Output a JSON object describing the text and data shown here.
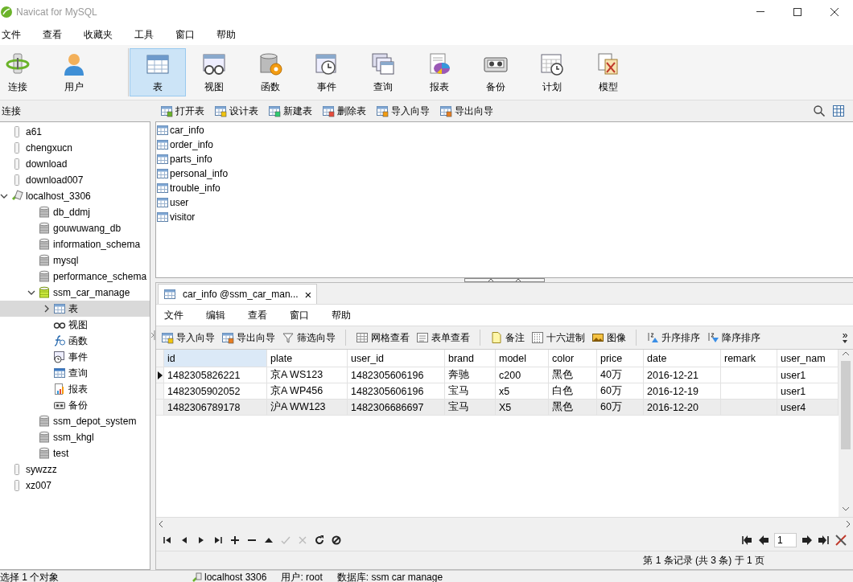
{
  "window": {
    "title": "Navicat for MySQL"
  },
  "menu": [
    "文件",
    "查看",
    "收藏夹",
    "工具",
    "窗口",
    "帮助"
  ],
  "toolbar": [
    {
      "label": "连接",
      "selected": false
    },
    {
      "label": "用户",
      "selected": false
    },
    {
      "label": "表",
      "selected": true
    },
    {
      "label": "视图",
      "selected": false
    },
    {
      "label": "函数",
      "selected": false
    },
    {
      "label": "事件",
      "selected": false
    },
    {
      "label": "查询",
      "selected": false
    },
    {
      "label": "报表",
      "selected": false
    },
    {
      "label": "备份",
      "selected": false
    },
    {
      "label": "计划",
      "selected": false
    },
    {
      "label": "模型",
      "selected": false
    }
  ],
  "sidebar": {
    "header": "连接",
    "tree": [
      {
        "label": "a61",
        "kind": "connection",
        "open": false,
        "selected": false
      },
      {
        "label": "chengxucn",
        "kind": "connection",
        "open": false,
        "selected": false
      },
      {
        "label": "download",
        "kind": "connection",
        "open": false,
        "selected": false
      },
      {
        "label": "download007",
        "kind": "connection",
        "open": false,
        "selected": false
      },
      {
        "label": "localhost_3306",
        "kind": "connection",
        "open": true,
        "selected": false,
        "expanded": true,
        "children": [
          {
            "label": "db_ddmj",
            "kind": "database",
            "open": false,
            "selected": false
          },
          {
            "label": "gouwuwang_db",
            "kind": "database",
            "open": false,
            "selected": false
          },
          {
            "label": "information_schema",
            "kind": "database",
            "open": false,
            "selected": false
          },
          {
            "label": "mysql",
            "kind": "database",
            "open": false,
            "selected": false
          },
          {
            "label": "performance_schema",
            "kind": "database",
            "open": false,
            "selected": false
          },
          {
            "label": "ssm_car_manage",
            "kind": "database",
            "open": true,
            "selected": false,
            "expanded": true,
            "children": [
              {
                "label": "表",
                "kind": "tables",
                "selected": true,
                "expanded": false
              },
              {
                "label": "视图",
                "kind": "views",
                "selected": false
              },
              {
                "label": "函数",
                "kind": "functions",
                "selected": false
              },
              {
                "label": "事件",
                "kind": "events",
                "selected": false
              },
              {
                "label": "查询",
                "kind": "queries",
                "selected": false
              },
              {
                "label": "报表",
                "kind": "reports",
                "selected": false
              },
              {
                "label": "备份",
                "kind": "backups",
                "selected": false
              }
            ]
          },
          {
            "label": "ssm_depot_system",
            "kind": "database",
            "open": false,
            "selected": false
          },
          {
            "label": "ssm_khgl",
            "kind": "database",
            "open": false,
            "selected": false
          },
          {
            "label": "test",
            "kind": "database",
            "open": false,
            "selected": false
          }
        ]
      },
      {
        "label": "sywzzz",
        "kind": "connection",
        "open": false,
        "selected": false
      },
      {
        "label": "xz007",
        "kind": "connection",
        "open": false,
        "selected": false
      }
    ]
  },
  "object_toolbar": [
    "打开表",
    "设计表",
    "新建表",
    "删除表",
    "导入向导",
    "导出向导"
  ],
  "objects": [
    "car_info",
    "order_info",
    "parts_info",
    "personal_info",
    "trouble_info",
    "user",
    "visitor"
  ],
  "tab": {
    "label": "car_info @ssm_car_man...",
    "close": "×",
    "selected": true
  },
  "editor_menu": [
    "文件",
    "编辑",
    "查看",
    "窗口",
    "帮助"
  ],
  "editor_toolbar": [
    [
      "导入向导",
      "导出向导",
      "筛选向导"
    ],
    [
      "网格查看",
      "表单查看"
    ],
    [
      "备注",
      "十六进制",
      "图像"
    ],
    [
      "升序排序",
      "降序排序"
    ]
  ],
  "toolbar_overflow": "»",
  "table": {
    "columns": [
      {
        "label": "id",
        "selected": true
      },
      {
        "label": "plate",
        "selected": false
      },
      {
        "label": "user_id",
        "selected": false
      },
      {
        "label": "brand",
        "selected": false
      },
      {
        "label": "model",
        "selected": false
      },
      {
        "label": "color",
        "selected": false
      },
      {
        "label": "price",
        "selected": false
      },
      {
        "label": "date",
        "selected": false
      },
      {
        "label": "remark",
        "selected": false
      },
      {
        "label": "user_nam",
        "selected": false
      }
    ],
    "rows": [
      {
        "current": true,
        "highlighted": false,
        "cells": [
          "1482305826221",
          "京A WS123",
          "1482305606196",
          "奔驰",
          "c200",
          "黑色",
          "40万",
          "2016-12-21",
          "",
          "user1"
        ]
      },
      {
        "current": false,
        "highlighted": false,
        "cells": [
          "1482305902052",
          "京A WP456",
          "1482305606196",
          "宝马",
          "x5",
          "白色",
          "60万",
          "2016-12-19",
          "",
          "user1"
        ]
      },
      {
        "current": false,
        "highlighted": true,
        "cells": [
          "1482306789178",
          "沪A WW123",
          "1482306686697",
          "宝马",
          "X5",
          "黑色",
          "60万",
          "2016-12-20",
          "",
          "user4"
        ]
      }
    ]
  },
  "nav_buttons": [
    {
      "disabled": false
    },
    {
      "disabled": false
    },
    {
      "disabled": false
    },
    {
      "disabled": false
    },
    {
      "disabled": false
    },
    {
      "disabled": false
    },
    {
      "disabled": false
    },
    {
      "disabled": true
    },
    {
      "disabled": true
    },
    {
      "disabled": false
    },
    {
      "disabled": false
    }
  ],
  "page": "1",
  "record_status": "第 1 条记录 (共 3 条) 于 1 页",
  "status_bar": {
    "selection": "选择 1 个对象",
    "connection": "localhost 3306",
    "user": "用户: root",
    "database": "数据库: ssm car manage"
  }
}
